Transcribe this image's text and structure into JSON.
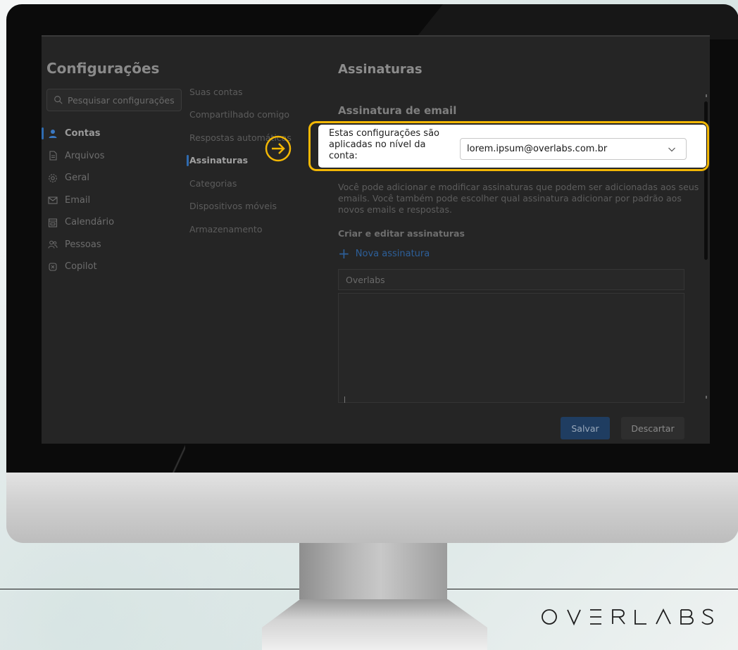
{
  "app": {
    "title": "Configurações",
    "search_placeholder": "Pesquisar configurações"
  },
  "nav_primary": [
    {
      "label": "Contas",
      "icon": "person-icon",
      "active": true
    },
    {
      "label": "Arquivos",
      "icon": "document-icon",
      "active": false
    },
    {
      "label": "Geral",
      "icon": "gear-icon",
      "active": false
    },
    {
      "label": "Email",
      "icon": "mail-icon",
      "active": false
    },
    {
      "label": "Calendário",
      "icon": "calendar-icon",
      "active": false
    },
    {
      "label": "Pessoas",
      "icon": "people-icon",
      "active": false
    },
    {
      "label": "Copilot",
      "icon": "copilot-icon",
      "active": false
    }
  ],
  "nav_secondary": [
    {
      "label": "Suas contas",
      "active": false
    },
    {
      "label": "Compartilhado comigo",
      "active": false
    },
    {
      "label": "Respostas automáticas",
      "active": false
    },
    {
      "label": "Assinaturas",
      "active": true
    },
    {
      "label": "Categorias",
      "active": false
    },
    {
      "label": "Dispositivos móveis",
      "active": false
    },
    {
      "label": "Armazenamento",
      "active": false
    }
  ],
  "content": {
    "title": "Assinaturas",
    "subtitle": "Assinatura de email",
    "scope_label": "Estas configurações são aplicadas no nível da conta:",
    "account_select_value": "lorem.ipsum@overlabs.com.br",
    "description": "Você pode adicionar e modificar assinaturas que podem ser adicionadas aos seus emails. Você também pode escolher qual assinatura adicionar por padrão aos novos emails e respostas.",
    "create_edit_label": "Criar e editar assinaturas",
    "new_signature_label": "Nova assinatura",
    "signature_name_value": "Overlabs",
    "save_label": "Salvar",
    "discard_label": "Descartar"
  },
  "annotation": {
    "highlight_color": "#f2b705"
  },
  "brand": {
    "logo_text": "OVERLABS"
  }
}
